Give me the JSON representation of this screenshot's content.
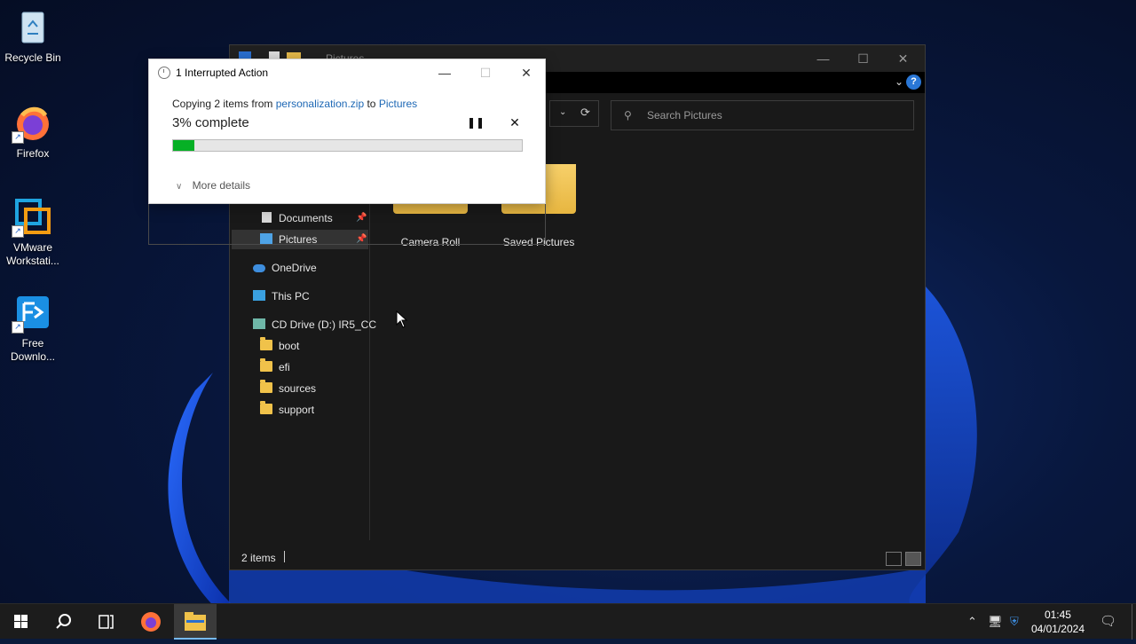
{
  "desktop": {
    "icons": [
      {
        "label": "Recycle Bin"
      },
      {
        "label": "Firefox"
      },
      {
        "label": "VMware Workstati..."
      },
      {
        "label": "Free Downlo..."
      }
    ]
  },
  "explorer": {
    "title": "Pictures",
    "search_placeholder": "Search Pictures",
    "nav": {
      "documents": "Documents",
      "pictures": "Pictures",
      "onedrive": "OneDrive",
      "this_pc": "This PC",
      "cd_drive": "CD Drive (D:) IR5_CC",
      "boot": "boot",
      "efi": "efi",
      "sources": "sources",
      "support": "support"
    },
    "folders": [
      {
        "name": "Camera Roll"
      },
      {
        "name": "Saved Pictures"
      }
    ],
    "status": "2 items"
  },
  "dialog": {
    "title": "1 Interrupted Action",
    "copy_prefix": "Copying 2 items from",
    "source": "personalization.zip",
    "to_word": "to",
    "destination": "Pictures",
    "percent_text": "3% complete",
    "progress": 0.06,
    "more_details": "More details",
    "progress_color": "#06b025"
  },
  "taskbar": {
    "time": "01:45",
    "date": "04/01/2024"
  }
}
